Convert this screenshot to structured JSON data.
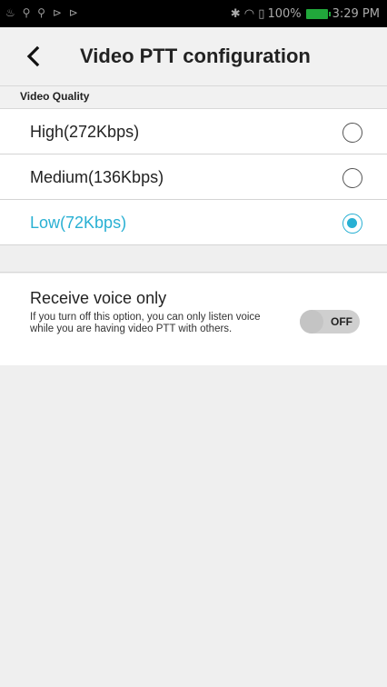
{
  "status_bar": {
    "left_icons": "♨ ⚲ ⚲ ⊳ ⊳",
    "right_icons": "✱ ◠ ▯",
    "battery_percent": "100%",
    "time": "3:29 PM"
  },
  "header": {
    "back_icon": "chevron-left-icon",
    "title": "Video PTT configuration"
  },
  "video_quality": {
    "section_label": "Video Quality",
    "options": [
      {
        "label": "High(272Kbps)",
        "selected": false
      },
      {
        "label": "Medium(136Kbps)",
        "selected": false
      },
      {
        "label": "Low(72Kbps)",
        "selected": true
      }
    ]
  },
  "receive_voice": {
    "title": "Receive voice only",
    "description": "If you turn off this option, you can only listen voice while you are having video PTT with others.",
    "toggle_state": "OFF",
    "enabled": false
  },
  "colors": {
    "accent": "#29b0d3",
    "battery": "#21a83b"
  }
}
